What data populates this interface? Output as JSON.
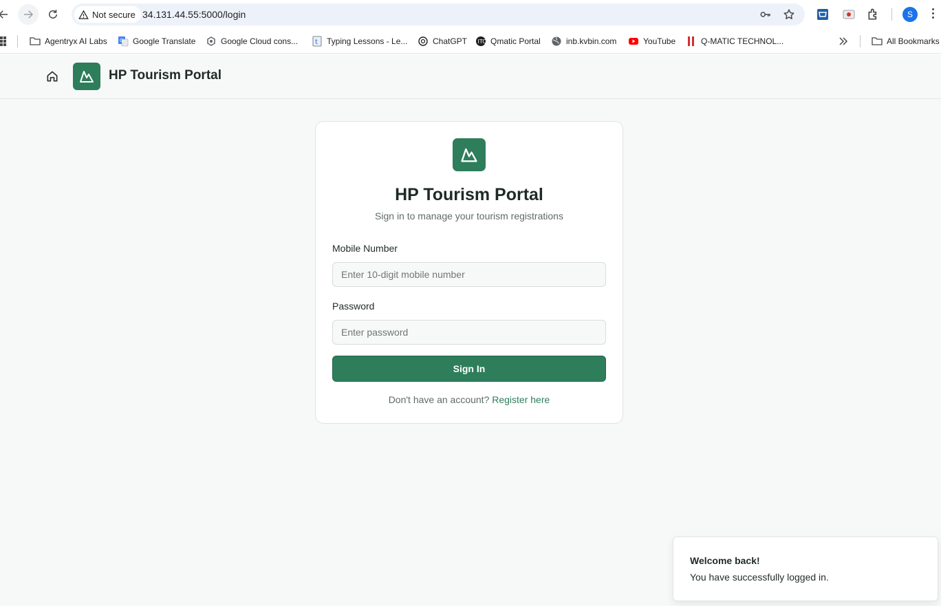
{
  "browser": {
    "security_label": "Not secure",
    "url": "34.131.44.55:5000/login",
    "profile_initial": "S",
    "bookmarks": [
      {
        "label": "Agentryx AI Labs",
        "icon": "folder-icon"
      },
      {
        "label": "Google Translate",
        "icon": "google-translate-icon"
      },
      {
        "label": "Google Cloud cons...",
        "icon": "google-cloud-icon"
      },
      {
        "label": "Typing Lessons - Le...",
        "icon": "typing-lessons-icon"
      },
      {
        "label": "ChatGPT",
        "icon": "chatgpt-icon"
      },
      {
        "label": "Qmatic Portal",
        "icon": "qmatic-icon"
      },
      {
        "label": "inb.kvbin.com",
        "icon": "globe-icon"
      },
      {
        "label": "YouTube",
        "icon": "youtube-icon"
      },
      {
        "label": "Q-MATIC TECHNOL...",
        "icon": "q-matic-icon"
      }
    ],
    "all_bookmarks_label": "All Bookmarks",
    "colors": {
      "youtube": "#ff0000",
      "q_matic": "#d32f2f",
      "avatar": "#1a73e8"
    }
  },
  "header": {
    "brand_name": "HP Tourism Portal"
  },
  "login": {
    "title": "HP Tourism Portal",
    "subtitle": "Sign in to manage your tourism registrations",
    "mobile_label": "Mobile Number",
    "mobile_placeholder": "Enter 10-digit mobile number",
    "mobile_value": "",
    "password_label": "Password",
    "password_placeholder": "Enter password",
    "password_value": "",
    "signin_label": "Sign In",
    "register_prompt": "Don't have an account?",
    "register_link": "Register here"
  },
  "toast": {
    "title": "Welcome back!",
    "message": "You have successfully logged in."
  },
  "theme": {
    "accent": "#2e7d5b",
    "page_bg": "#f7f9f8"
  }
}
